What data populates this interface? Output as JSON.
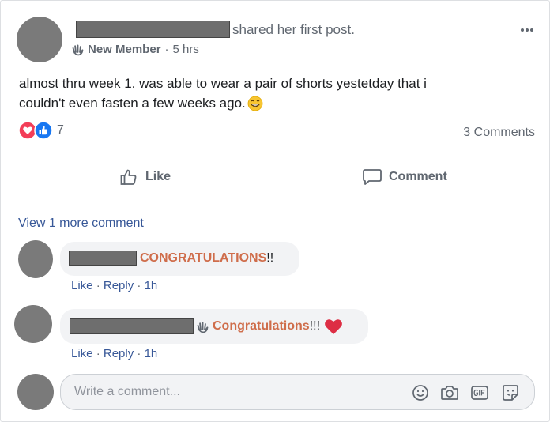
{
  "post": {
    "header_action": "shared her first post.",
    "badge": "New Member",
    "separator": "·",
    "time": "5 hrs",
    "body_line1": "almost thru week 1. was able to wear a pair of shorts yestetday that i",
    "body_line2": "couldn't even fasten a few weeks ago.",
    "reaction_count": "7",
    "comments_count": "3 Comments",
    "like_label": "Like",
    "comment_label": "Comment"
  },
  "comments": {
    "view_more": "View 1 more comment",
    "items": [
      {
        "text_highlight": "CONGRATULATIONS",
        "text_rest": "!!",
        "like": "Like",
        "reply": "Reply",
        "time": "1h"
      },
      {
        "text_highlight": "Congratulations",
        "text_rest": "!!!",
        "like": "Like",
        "reply": "Reply",
        "time": "1h"
      }
    ],
    "input_placeholder": "Write a comment..."
  },
  "icons": {
    "wave": "waving-hand-icon",
    "grin": "grinning-face-emoji",
    "heart": "heart-emoji",
    "love_reaction": "love-reaction-icon",
    "like_reaction": "like-reaction-icon",
    "more": "more-options-icon",
    "thumb": "thumbs-up-icon",
    "speech": "comment-bubble-icon",
    "smiley": "emoji-icon",
    "camera": "camera-icon",
    "gif": "gif-icon",
    "sticker": "sticker-icon"
  },
  "colors": {
    "accent_link": "#385898",
    "highlight": "#cf6d4b",
    "love": "#f33e58",
    "like": "#1877f2"
  }
}
